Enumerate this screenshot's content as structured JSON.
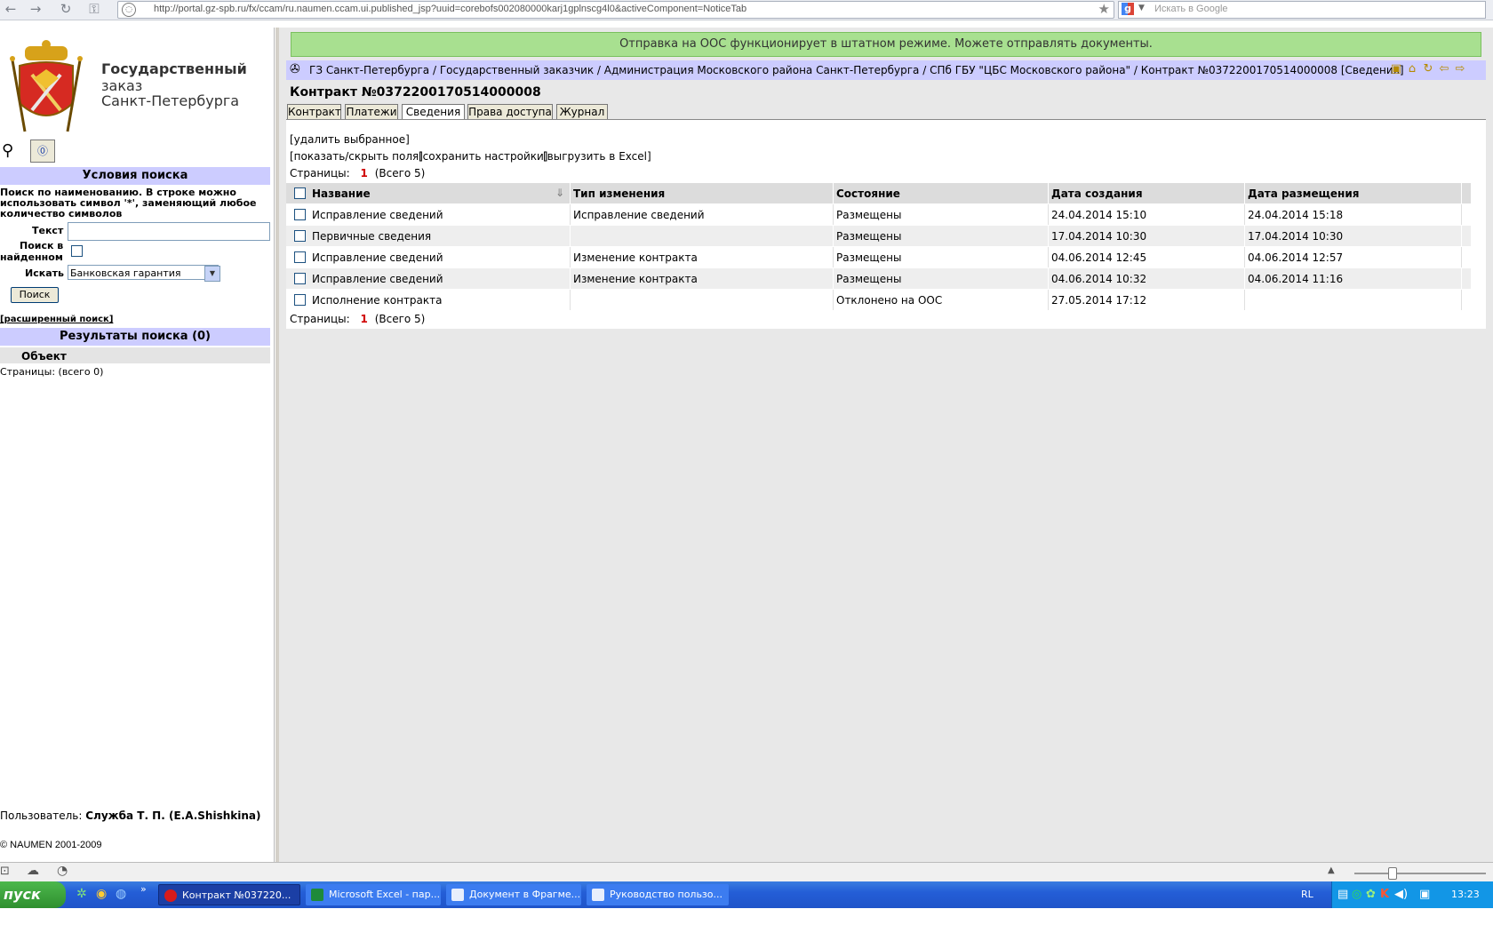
{
  "browser": {
    "url": "http://portal.gz-spb.ru/fx/ccam/ru.naumen.ccam.ui.published_jsp?uuid=corebofs002080000karj1gplnscg4l0&activeComponent=NoticeTab",
    "search_placeholder": "Искать в Google"
  },
  "logo": {
    "line1": "Государственный",
    "line2": "заказ",
    "line3": "Санкт-Петербурга"
  },
  "search": {
    "title": "Условия поиска",
    "hint": "Поиск по наименованию. В строке можно использовать символ '*', заменяющий любое количество символов",
    "text_label": "Текст",
    "text_value": "",
    "in_found_label_1": "Поиск в",
    "in_found_label_2": "найденном",
    "search_in_label": "Искать",
    "search_in_value": "Банковская гарантия",
    "button": "Поиск",
    "advanced": "[расширенный поиск]"
  },
  "results": {
    "title": "Результаты поиска (0)",
    "column": "Объект",
    "pages": "Страницы:  (всего 0)"
  },
  "user": {
    "label": "Пользователь:",
    "name": "Служба Т. П. (E.A.Shishkina)"
  },
  "copyright": "© NAUMEN 2001-2009",
  "notice": "Отправка на ООС функционирует в штатном режиме. Можете отправлять документы.",
  "breadcrumb": "ГЗ Санкт-Петербурга / Государственный заказчик / Администрация Московского района Санкт-Петербурга / СПб ГБУ \"ЦБС Московского района\" / Контракт №0372200170514000008 [Сведения]",
  "page_title": "Контракт №0372200170514000008",
  "tabs": [
    "Контракт",
    "Платежи",
    "Сведения",
    "Права доступа",
    "Журнал"
  ],
  "actions": {
    "delete": "[удалить выбранное]",
    "toggle_fields": "[показать/скрыть поля]",
    "save_settings": "[сохранить настройки]",
    "export_excel": "[выгрузить в Excel]"
  },
  "paging": {
    "label": "Страницы:",
    "current": "1",
    "total": "(Всего 5)"
  },
  "table": {
    "headers": [
      "Название",
      "Тип изменения",
      "Состояние",
      "Дата создания",
      "Дата размещения"
    ],
    "rows": [
      [
        "Исправление сведений",
        "Исправление сведений",
        "Размещены",
        "24.04.2014 15:10",
        "24.04.2014 15:18"
      ],
      [
        "Первичные сведения",
        "",
        "Размещены",
        "17.04.2014 10:30",
        "17.04.2014 10:30"
      ],
      [
        "Исправление сведений",
        "Изменение контракта",
        "Размещены",
        "04.06.2014 12:45",
        "04.06.2014 12:57"
      ],
      [
        "Исправление сведений",
        "Изменение контракта",
        "Размещены",
        "04.06.2014 10:32",
        "04.06.2014 11:16"
      ],
      [
        "Исполнение контракта",
        "",
        "Отклонено на ООС",
        "27.05.2014 17:12",
        ""
      ]
    ]
  },
  "taskbar": {
    "start": "пуск",
    "items": [
      "Контракт №037220...",
      "Microsoft Excel - пар...",
      "Документ в Фрагме...",
      "Руководство пользо..."
    ],
    "lang": "RL",
    "time": "13:23"
  },
  "colors": {
    "notice_bg": "#a8e090",
    "header_bar": "#ccccff",
    "taskbar": "#245ed7",
    "accent_red": "#d00000"
  }
}
